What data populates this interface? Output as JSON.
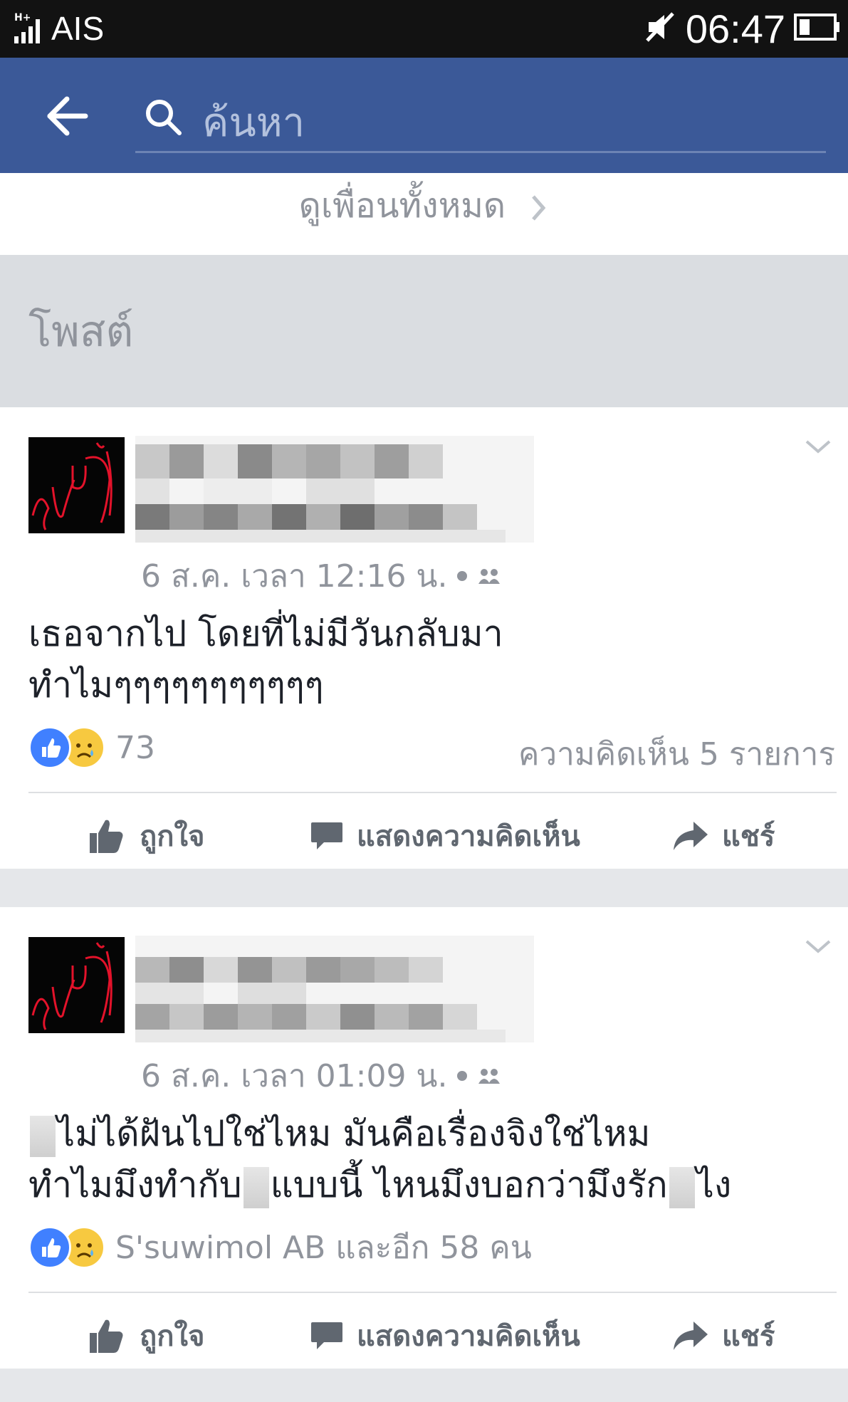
{
  "status_bar": {
    "carrier": "AIS",
    "time": "06:47"
  },
  "nav": {
    "search_placeholder": "ค้นหา"
  },
  "see_all_friends": "ดูเพื่อนทั้งหมด",
  "section_title": "โพสต์",
  "posts": [
    {
      "timestamp": "6 ส.ค. เวลา 12:16 น.",
      "text_lines": [
        "เธอจากไป โดยที่ไม่มีวันกลับมา",
        "ทำไมๆๆๆๆๆๆๆๆๆๆๆ"
      ],
      "reactions_text": "73",
      "comments_text": "ความคิดเห็น 5 รายการ"
    },
    {
      "timestamp": "6 ส.ค. เวลา 01:09 น.",
      "text_line1": "ไม่ได้ฝันไปใช่ไหม มันคือเรื่องจิงใช่ไหม",
      "text_line2_a": "ทำไมมึงทำกับ",
      "text_line2_b": "แบบนี้ ไหนมึงบอกว่ามึงรัก",
      "text_line2_c": "ไง",
      "reactions_text": "S'suwimol AB และอีก 58 คน"
    }
  ],
  "actions": {
    "like": "ถูกใจ",
    "comment": "แสดงความคิดเห็น",
    "share": "แชร์"
  },
  "avatar_text": "รูปคู่",
  "colors": {
    "nav": "#3b5998",
    "like_blue": "#4080ff",
    "muted": "#90949c"
  }
}
